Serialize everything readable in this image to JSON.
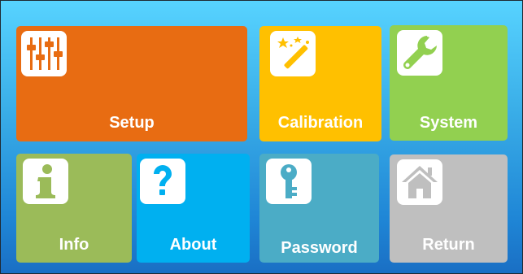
{
  "tiles": [
    {
      "id": "setup",
      "label": "Setup",
      "color": "#e86c12",
      "icon": "sliders-icon"
    },
    {
      "id": "calibration",
      "label": "Calibration",
      "color": "#ffc000",
      "icon": "magic-wand-icon"
    },
    {
      "id": "system",
      "label": "System",
      "color": "#92d050",
      "icon": "wrench-icon"
    },
    {
      "id": "info",
      "label": "Info",
      "color": "#9bbb59",
      "icon": "info-icon"
    },
    {
      "id": "about",
      "label": "About",
      "color": "#00b0f0",
      "icon": "question-icon"
    },
    {
      "id": "password",
      "label": "Password",
      "color": "#4bacc6",
      "icon": "key-icon"
    },
    {
      "id": "return",
      "label": "Return",
      "color": "#bfbfbf",
      "icon": "home-icon"
    }
  ]
}
